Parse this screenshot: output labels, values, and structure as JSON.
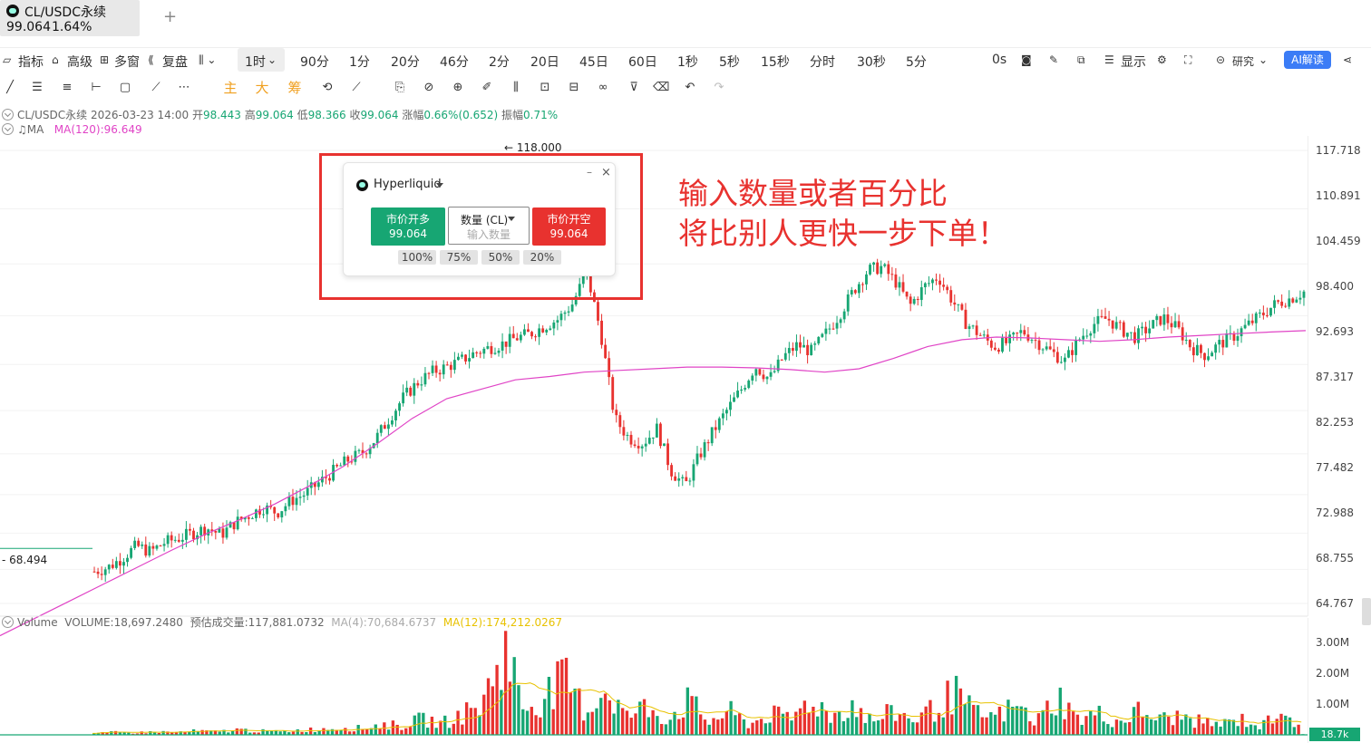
{
  "tab": {
    "symbol": "CL/USDC永续",
    "price": "99.064",
    "change": "1.64%",
    "add_icon": "plus-icon"
  },
  "toolbar": {
    "indicators": "指标",
    "advanced": "高级",
    "multi_window": "多窗",
    "replay": "复盘",
    "intervals": [
      "1时",
      "90分",
      "1分",
      "20分",
      "46分",
      "2分",
      "20日",
      "45日",
      "60日",
      "1秒",
      "5秒",
      "15秒",
      "分时",
      "30秒",
      "5分"
    ],
    "active_interval": "1时",
    "countdown": "0s",
    "display": "显示",
    "research": "研究",
    "ai_read": "AI解读"
  },
  "drawbar": {
    "main": "主",
    "big": "大",
    "chips": "筹"
  },
  "info": {
    "symbol": "CL/USDC永续",
    "datetime": "2026-03-23 14:00",
    "open_label": "开",
    "open": "98.443",
    "high_label": "高",
    "high": "99.064",
    "low_label": "低",
    "low": "98.366",
    "close_label": "收",
    "close": "99.064",
    "change_label": "涨幅",
    "change": "0.66%(0.652)",
    "amplitude_label": "振幅",
    "amplitude": "0.71%",
    "ma_name": "MA",
    "ma_value": "MA(120):96.649"
  },
  "price_axis": [
    "117.718",
    "110.891",
    "104.459",
    "98.400",
    "92.693",
    "87.317",
    "82.253",
    "77.482",
    "72.988",
    "68.755",
    "64.767"
  ],
  "max_label": "← 118.000",
  "min_label": "- 68.494",
  "volume": {
    "name": "Volume",
    "value": "VOLUME:18,697.2480",
    "forecast": "预估成交量:117,881.0732",
    "ma4": "MA(4):70,684.6737",
    "ma12": "MA(12):174,212.0267",
    "axis": [
      "3.00M",
      "2.00M",
      "1.00M"
    ],
    "last": "18.7k"
  },
  "widget": {
    "exchange": "Hyperliquid",
    "long_label": "市价开多",
    "long_price": "99.064",
    "short_label": "市价开空",
    "short_price": "99.064",
    "qty_label": "数量 (CL)",
    "qty_placeholder": "输入数量",
    "percents": [
      "100%",
      "75%",
      "50%",
      "20%"
    ],
    "minimize": "–",
    "close": "×"
  },
  "annotation": {
    "line1": "输入数量或者百分比",
    "line2": "将比别人更快一步下单！"
  },
  "colors": {
    "up": "#17a673",
    "down": "#e8322f",
    "ma": "#e044c6",
    "accent": "#3b7cf6",
    "annotation": "#e8322f"
  },
  "chart_data": {
    "type": "candlestick",
    "symbol": "CL/USDC永续",
    "interval": "1时",
    "ylim": [
      64.767,
      117.718
    ],
    "close_series": [
      68.5,
      69.0,
      70.1,
      71.5,
      70.8,
      71.9,
      72.4,
      73.0,
      73.6,
      72.8,
      74.2,
      75.1,
      76.0,
      75.4,
      76.8,
      77.6,
      78.9,
      80.2,
      81.5,
      82.3,
      84.0,
      86.5,
      88.9,
      90.6,
      91.8,
      92.4,
      93.1,
      94.0,
      94.6,
      95.1,
      95.8,
      96.3,
      97.2,
      98.0,
      99.8,
      103.5,
      96.5,
      86.4,
      84.1,
      83.5,
      85.2,
      80.3,
      78.5,
      82.0,
      84.9,
      87.4,
      89.8,
      92.5,
      91.0,
      93.6,
      95.0,
      94.2,
      96.3,
      98.6,
      101.4,
      103.7,
      104.1,
      102.3,
      99.6,
      101.8,
      103.0,
      100.2,
      97.5,
      96.1,
      94.8,
      95.3,
      96.6,
      95.4,
      94.2,
      93.1,
      95.6,
      97.4,
      98.1,
      96.8,
      95.9,
      97.0,
      98.2,
      96.9,
      94.7,
      93.8,
      95.1,
      96.0,
      97.3,
      98.5,
      99.8,
      100.4,
      101.2
    ],
    "ma_series": [
      61.0,
      63.0,
      65.0,
      67.0,
      69.0,
      71.0,
      72.9,
      74.6,
      76.4,
      78.5,
      80.8,
      83.5,
      86.4,
      88.7,
      89.8,
      90.9,
      91.3,
      91.8,
      92.0,
      92.2,
      92.4,
      92.4,
      92.3,
      92.1,
      91.8,
      92.2,
      93.4,
      94.8,
      95.6,
      95.9,
      95.8,
      95.6,
      95.4,
      95.6,
      95.9,
      96.1,
      96.3,
      96.5,
      96.649
    ],
    "volume_ylim": [
      0,
      3.6
    ],
    "volume_series": [
      0.05,
      0.1,
      0.08,
      0.12,
      0.1,
      0.15,
      0.12,
      0.2,
      0.15,
      0.12,
      0.18,
      0.22,
      0.3,
      0.25,
      0.4,
      0.35,
      0.6,
      0.45,
      0.8,
      1.2,
      3.5,
      1.0,
      1.5,
      2.1,
      0.9,
      1.8,
      0.7,
      1.1,
      0.6,
      1.3,
      0.5,
      0.9,
      0.4,
      0.8,
      0.6,
      1.4,
      0.7,
      1.2,
      0.5,
      0.9,
      0.6,
      1.0,
      1.6,
      0.8,
      0.7,
      1.1,
      0.5,
      1.5,
      0.6,
      0.8,
      0.5,
      0.9,
      0.6,
      0.7,
      0.5,
      0.4,
      0.6,
      0.3,
      1.2,
      0.0187
    ]
  }
}
